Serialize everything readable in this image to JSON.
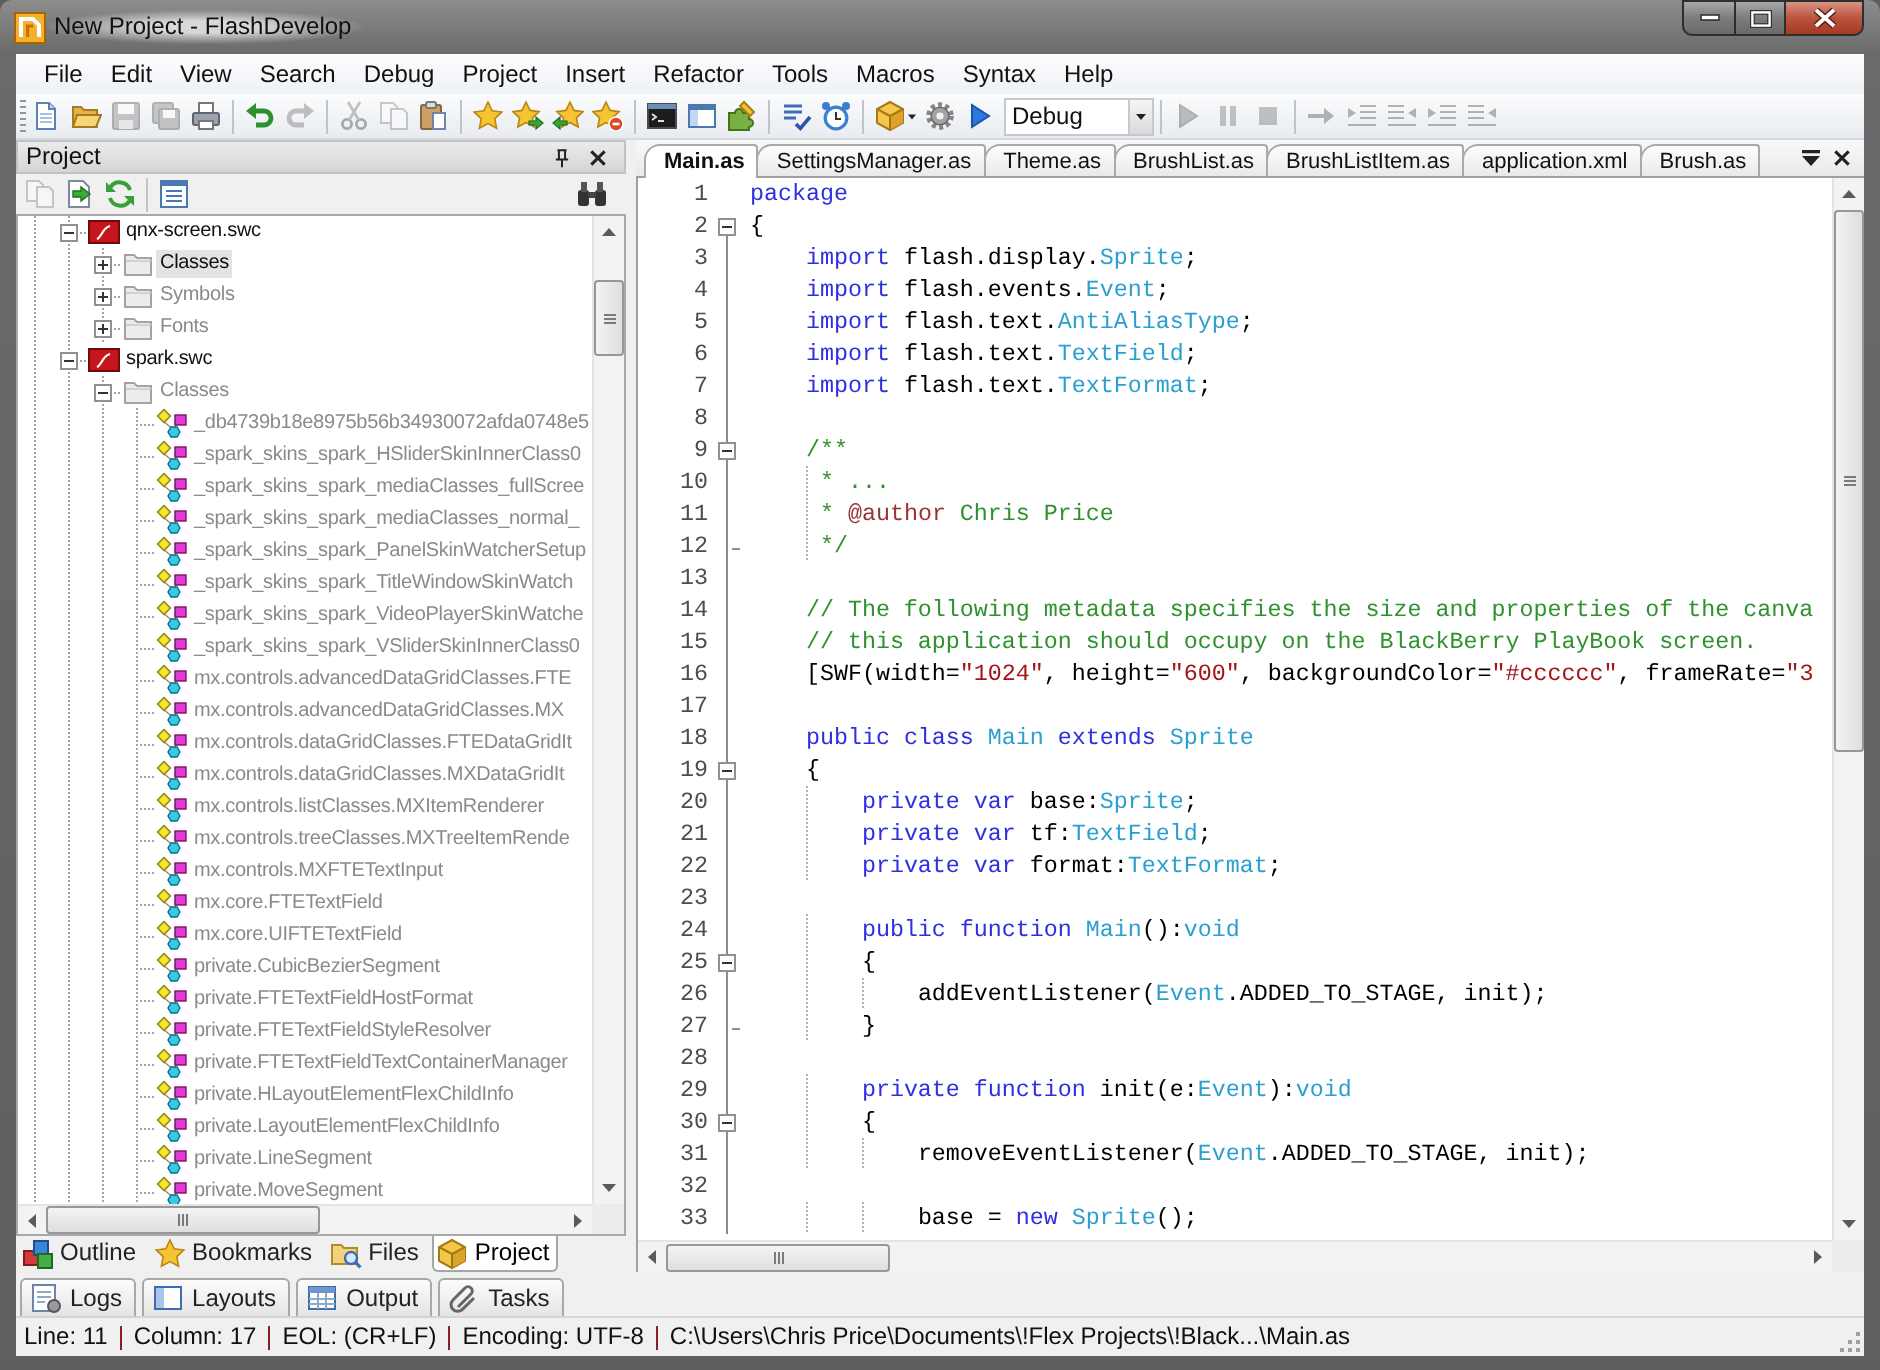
{
  "window": {
    "title": "New Project - FlashDevelop"
  },
  "menu": [
    "File",
    "Edit",
    "View",
    "Search",
    "Debug",
    "Project",
    "Insert",
    "Refactor",
    "Tools",
    "Macros",
    "Syntax",
    "Help"
  ],
  "toolbar": {
    "buttons": [
      {
        "disabled": false
      },
      {
        "disabled": false
      },
      {
        "disabled": true
      },
      {
        "disabled": true
      },
      {
        "disabled": false
      },
      {
        "disabled": false
      },
      {
        "disabled": true
      },
      {
        "disabled": true
      },
      {
        "disabled": true
      },
      {
        "disabled": false
      },
      {
        "disabled": false
      },
      {
        "disabled": false
      },
      {
        "disabled": false
      },
      {
        "disabled": false
      },
      {
        "disabled": false
      },
      {
        "disabled": false
      },
      {
        "disabled": false
      },
      {
        "disabled": false
      },
      {
        "disabled": false
      },
      {
        "disabled": false
      },
      {
        "disabled": false
      },
      {
        "disabled": false
      },
      {
        "disabled": true
      },
      {
        "disabled": true
      },
      {
        "disabled": true
      },
      {
        "disabled": true
      },
      {
        "disabled": true
      },
      {
        "disabled": true
      },
      {
        "disabled": true
      },
      {
        "disabled": true
      }
    ],
    "configuration": "Debug"
  },
  "project_panel": {
    "title": "Project",
    "toolbar": [
      {
        "disabled": true
      },
      {
        "disabled": false
      },
      {
        "disabled": false
      },
      {
        "disabled": false
      },
      {
        "disabled": false
      }
    ],
    "tree": [
      {
        "label": "qnx-screen.swc",
        "kind": "library",
        "expanded": true,
        "selected": false,
        "children": [
          {
            "label": "Classes",
            "kind": "folder",
            "expanded": false,
            "selected": true
          },
          {
            "label": "Symbols",
            "kind": "folder",
            "expanded": false,
            "selected": false
          },
          {
            "label": "Fonts",
            "kind": "folder",
            "expanded": false,
            "selected": false
          }
        ]
      },
      {
        "label": "spark.swc",
        "kind": "library",
        "expanded": true,
        "selected": false,
        "children": [
          {
            "label": "Classes",
            "kind": "folder",
            "expanded": true,
            "selected": false,
            "children": [
              {
                "label": "_db4739b18e8975b56b34930072afda0748e5",
                "kind": "class",
                "selected": false
              },
              {
                "label": "_spark_skins_spark_HSliderSkinInnerClass0",
                "kind": "class",
                "selected": false
              },
              {
                "label": "_spark_skins_spark_mediaClasses_fullScree",
                "kind": "class",
                "selected": false
              },
              {
                "label": "_spark_skins_spark_mediaClasses_normal_",
                "kind": "class",
                "selected": false
              },
              {
                "label": "_spark_skins_spark_PanelSkinWatcherSetup",
                "kind": "class",
                "selected": false
              },
              {
                "label": "_spark_skins_spark_TitleWindowSkinWatch",
                "kind": "class",
                "selected": false
              },
              {
                "label": "_spark_skins_spark_VideoPlayerSkinWatche",
                "kind": "class",
                "selected": false
              },
              {
                "label": "_spark_skins_spark_VSliderSkinInnerClass0",
                "kind": "class",
                "selected": false
              },
              {
                "label": "mx.controls.advancedDataGridClasses.FTE",
                "kind": "class",
                "selected": false
              },
              {
                "label": "mx.controls.advancedDataGridClasses.MX",
                "kind": "class",
                "selected": false
              },
              {
                "label": "mx.controls.dataGridClasses.FTEDataGridIt",
                "kind": "class",
                "selected": false
              },
              {
                "label": "mx.controls.dataGridClasses.MXDataGridIt",
                "kind": "class",
                "selected": false
              },
              {
                "label": "mx.controls.listClasses.MXItemRenderer",
                "kind": "class",
                "selected": false
              },
              {
                "label": "mx.controls.treeClasses.MXTreeItemRende",
                "kind": "class",
                "selected": false
              },
              {
                "label": "mx.controls.MXFTETextInput",
                "kind": "class",
                "selected": false
              },
              {
                "label": "mx.core.FTETextField",
                "kind": "class",
                "selected": false
              },
              {
                "label": "mx.core.UIFTETextField",
                "kind": "class",
                "selected": false
              },
              {
                "label": "private.CubicBezierSegment",
                "kind": "class",
                "selected": false
              },
              {
                "label": "private.FTETextFieldHostFormat",
                "kind": "class",
                "selected": false
              },
              {
                "label": "private.FTETextFieldStyleResolver",
                "kind": "class",
                "selected": false
              },
              {
                "label": "private.FTETextFieldTextContainerManager",
                "kind": "class",
                "selected": false
              },
              {
                "label": "private.HLayoutElementFlexChildInfo",
                "kind": "class",
                "selected": false
              },
              {
                "label": "private.LayoutElementFlexChildInfo",
                "kind": "class",
                "selected": false
              },
              {
                "label": "private.LineSegment",
                "kind": "class",
                "selected": false
              },
              {
                "label": "private.MoveSegment",
                "kind": "class",
                "selected": false
              }
            ]
          }
        ]
      }
    ],
    "tabs": [
      {
        "label": "Outline",
        "selected": false
      },
      {
        "label": "Bookmarks",
        "selected": false
      },
      {
        "label": "Files",
        "selected": false
      },
      {
        "label": "Project",
        "selected": true
      }
    ]
  },
  "editor": {
    "tabs": [
      {
        "label": "Main.as",
        "selected": true
      },
      {
        "label": "SettingsManager.as",
        "selected": false
      },
      {
        "label": "Theme.as",
        "selected": false
      },
      {
        "label": "BrushList.as",
        "selected": false
      },
      {
        "label": "BrushListItem.as",
        "selected": false
      },
      {
        "label": "application.xml",
        "selected": false
      },
      {
        "label": "Brush.as",
        "selected": false
      }
    ],
    "lines": [
      {
        "number": "1",
        "tokens": [
          {
            "kind": "keyword",
            "text": "package"
          }
        ]
      },
      {
        "number": "2",
        "expanded": true,
        "tokens": [
          {
            "kind": "plain",
            "text": "{"
          }
        ]
      },
      {
        "number": "3",
        "tokens": [
          {
            "kind": "keyword",
            "text": "    import"
          },
          {
            "kind": "plain",
            "text": " flash.display."
          },
          {
            "kind": "type",
            "text": "Sprite"
          },
          {
            "kind": "plain",
            "text": ";"
          }
        ]
      },
      {
        "number": "4",
        "tokens": [
          {
            "kind": "keyword",
            "text": "    import"
          },
          {
            "kind": "plain",
            "text": " flash.events."
          },
          {
            "kind": "type",
            "text": "Event"
          },
          {
            "kind": "plain",
            "text": ";"
          }
        ]
      },
      {
        "number": "5",
        "tokens": [
          {
            "kind": "keyword",
            "text": "    import"
          },
          {
            "kind": "plain",
            "text": " flash.text."
          },
          {
            "kind": "type",
            "text": "AntiAliasType"
          },
          {
            "kind": "plain",
            "text": ";"
          }
        ]
      },
      {
        "number": "6",
        "tokens": [
          {
            "kind": "keyword",
            "text": "    import"
          },
          {
            "kind": "plain",
            "text": " flash.text."
          },
          {
            "kind": "type",
            "text": "TextField"
          },
          {
            "kind": "plain",
            "text": ";"
          }
        ]
      },
      {
        "number": "7",
        "tokens": [
          {
            "kind": "keyword",
            "text": "    import"
          },
          {
            "kind": "plain",
            "text": " flash.text."
          },
          {
            "kind": "type",
            "text": "TextFormat"
          },
          {
            "kind": "plain",
            "text": ";"
          }
        ]
      },
      {
        "number": "8"
      },
      {
        "number": "9",
        "expanded": true,
        "tokens": [
          {
            "kind": "comment",
            "text": "    /**"
          }
        ]
      },
      {
        "number": "10",
        "tokens": [
          {
            "kind": "comment",
            "text": "     * ..."
          }
        ]
      },
      {
        "number": "11",
        "tokens": [
          {
            "kind": "comment",
            "text": "     * "
          },
          {
            "kind": "doc_tag",
            "text": "@author"
          },
          {
            "kind": "comment",
            "text": " Chris Price"
          }
        ]
      },
      {
        "number": "12",
        "block_end": true,
        "tokens": [
          {
            "kind": "comment",
            "text": "     */"
          }
        ]
      },
      {
        "number": "13"
      },
      {
        "number": "14",
        "tokens": [
          {
            "kind": "comment",
            "text": "    // The following metadata specifies the size and properties of the canva"
          }
        ]
      },
      {
        "number": "15",
        "tokens": [
          {
            "kind": "comment",
            "text": "    // this application should occupy on the BlackBerry PlayBook screen."
          }
        ]
      },
      {
        "number": "16",
        "tokens": [
          {
            "kind": "plain",
            "text": "    [SWF(width="
          },
          {
            "kind": "string",
            "text": "\"1024\""
          },
          {
            "kind": "plain",
            "text": ", height="
          },
          {
            "kind": "string",
            "text": "\"600\""
          },
          {
            "kind": "plain",
            "text": ", backgroundColor="
          },
          {
            "kind": "string",
            "text": "\"#cccccc\""
          },
          {
            "kind": "plain",
            "text": ", frameRate="
          },
          {
            "kind": "string",
            "text": "\"3"
          }
        ]
      },
      {
        "number": "17"
      },
      {
        "number": "18",
        "tokens": [
          {
            "kind": "keyword",
            "text": "    public "
          },
          {
            "kind": "keyword",
            "text": "class "
          },
          {
            "kind": "type",
            "text": "Main "
          },
          {
            "kind": "keyword",
            "text": "extends "
          },
          {
            "kind": "type",
            "text": "Sprite"
          }
        ]
      },
      {
        "number": "19",
        "expanded": true,
        "tokens": [
          {
            "kind": "plain",
            "text": "    {"
          }
        ]
      },
      {
        "number": "20",
        "tokens": [
          {
            "kind": "keyword",
            "text": "        private var"
          },
          {
            "kind": "plain",
            "text": " base:"
          },
          {
            "kind": "type",
            "text": "Sprite"
          },
          {
            "kind": "plain",
            "text": ";"
          }
        ]
      },
      {
        "number": "21",
        "tokens": [
          {
            "kind": "keyword",
            "text": "        private var"
          },
          {
            "kind": "plain",
            "text": " tf:"
          },
          {
            "kind": "type",
            "text": "TextField"
          },
          {
            "kind": "plain",
            "text": ";"
          }
        ]
      },
      {
        "number": "22",
        "tokens": [
          {
            "kind": "keyword",
            "text": "        private var"
          },
          {
            "kind": "plain",
            "text": " format:"
          },
          {
            "kind": "type",
            "text": "TextFormat"
          },
          {
            "kind": "plain",
            "text": ";"
          }
        ]
      },
      {
        "number": "23"
      },
      {
        "number": "24",
        "tokens": [
          {
            "kind": "keyword",
            "text": "        public function "
          },
          {
            "kind": "type",
            "text": "Main"
          },
          {
            "kind": "plain",
            "text": "():"
          },
          {
            "kind": "type",
            "text": "void"
          }
        ]
      },
      {
        "number": "25",
        "expanded": true,
        "tokens": [
          {
            "kind": "plain",
            "text": "        {"
          }
        ]
      },
      {
        "number": "26",
        "tokens": [
          {
            "kind": "plain",
            "text": "            addEventListener("
          },
          {
            "kind": "type",
            "text": "Event"
          },
          {
            "kind": "plain",
            "text": ".ADDED_TO_STAGE, init);"
          }
        ]
      },
      {
        "number": "27",
        "block_end": true,
        "tokens": [
          {
            "kind": "plain",
            "text": "        }"
          }
        ]
      },
      {
        "number": "28"
      },
      {
        "number": "29",
        "tokens": [
          {
            "kind": "keyword",
            "text": "        private function"
          },
          {
            "kind": "plain",
            "text": " init(e:"
          },
          {
            "kind": "type",
            "text": "Event"
          },
          {
            "kind": "plain",
            "text": "):"
          },
          {
            "kind": "type",
            "text": "void"
          }
        ]
      },
      {
        "number": "30",
        "expanded": true,
        "tokens": [
          {
            "kind": "plain",
            "text": "        {"
          }
        ]
      },
      {
        "number": "31",
        "tokens": [
          {
            "kind": "plain",
            "text": "            removeEventListener("
          },
          {
            "kind": "type",
            "text": "Event"
          },
          {
            "kind": "plain",
            "text": ".ADDED_TO_STAGE, init);"
          }
        ]
      },
      {
        "number": "32"
      },
      {
        "number": "33",
        "tokens": [
          {
            "kind": "plain",
            "text": "            base = "
          },
          {
            "kind": "keyword",
            "text": "new "
          },
          {
            "kind": "type",
            "text": "Sprite"
          },
          {
            "kind": "plain",
            "text": "();"
          }
        ]
      }
    ]
  },
  "output_tabs": [
    {
      "label": "Logs",
      "selected": false
    },
    {
      "label": "Layouts",
      "selected": false
    },
    {
      "label": "Output",
      "selected": false
    },
    {
      "label": "Tasks",
      "selected": false
    }
  ],
  "status_bar": [
    "Line: 11",
    "Column: 17",
    "EOL: (CR+LF)",
    "Encoding: UTF-8",
    "C:\\Users\\Chris Price\\Documents\\!Flex Projects\\!Black...\\Main.as"
  ]
}
